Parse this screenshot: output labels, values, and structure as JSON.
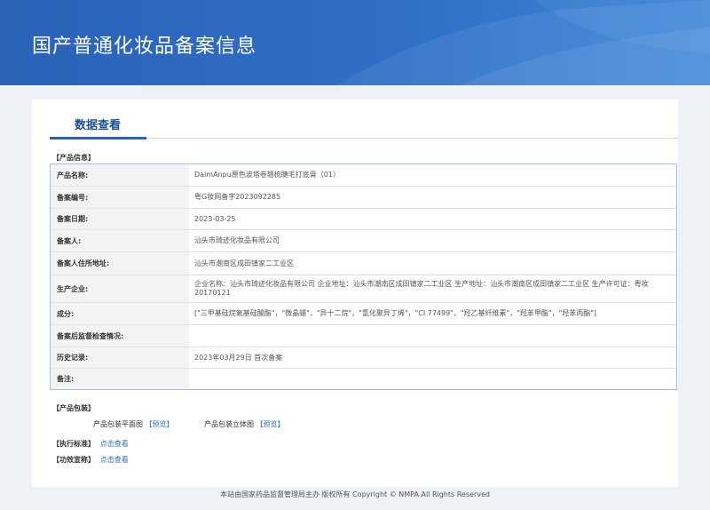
{
  "header": {
    "title": "国产普通化妆品备案信息"
  },
  "tabs": [
    {
      "label": "数据查看"
    }
  ],
  "product_info": {
    "section_label": "【产品信息】",
    "rows": [
      {
        "label": "产品名称:",
        "value": "DaimAnpu原色波塔卷翘梳睫毛打底膏（01）"
      },
      {
        "label": "备案编号:",
        "value": "粤G妆网备字2023092285"
      },
      {
        "label": "备案日期:",
        "value": "2023-03-25"
      },
      {
        "label": "备案人:",
        "value": "汕头市琦迹化妆品有限公司"
      },
      {
        "label": "备案人住所地址:",
        "value": "汕头市潮南区成田镇家二工业区"
      },
      {
        "label": "生产企业:",
        "value": "企业名称：汕头市琦迹化妆品有限公司 企业地址：汕头市潮南区成田镇家二工业区 生产地址：汕头市潮南区成田镇家二工业区 生产许可证：粤妆20170121"
      },
      {
        "label": "成分:",
        "value": "[\"三甲基硅烷氧基硅酸酯\"，\"微晶蜡\"，\"异十二烷\"，\"氢化聚异丁烯\"，\"CI 77499\"，\"羟乙基纤维素\"，\"羟苯甲酯\"，\"羟苯丙酯\"]"
      },
      {
        "label": "备案后监督检查情况:",
        "value": ""
      },
      {
        "label": "历史记录:",
        "value": "2023年03月29日 首次备案"
      },
      {
        "label": "备注:",
        "value": ""
      }
    ]
  },
  "packaging": {
    "section_label": "【产品包装】",
    "flat_label": "产品包装平面图",
    "flat_link": "预览",
    "solid_label": "产品包装立体图",
    "solid_link": "预览",
    "bracket_open": "【",
    "bracket_close": "】"
  },
  "standard": {
    "label": "【执行标准】",
    "link": "点击查看"
  },
  "efficacy": {
    "label": "【功效宣称】",
    "link": "点击查看"
  },
  "footer": {
    "text": "本站由国家药品监督管理局主办 版权所有 Copyright © NMPA All Rights Reserved"
  }
}
